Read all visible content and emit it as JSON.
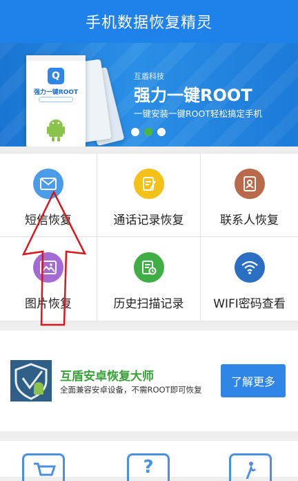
{
  "app": {
    "title": "手机数据恢复精灵"
  },
  "banner": {
    "brand": "互盾科技",
    "headline": "强力一键ROOT",
    "subtitle": "一键安装一键ROOT轻松搞定手机",
    "phone_title": "强力一键ROOT",
    "slide_count": 3,
    "active_slide": 2
  },
  "features": [
    {
      "label": "短信恢复",
      "icon": "message-icon",
      "color": "#4a9ce8"
    },
    {
      "label": "通话记录恢复",
      "icon": "call-log-icon",
      "color": "#f3c117"
    },
    {
      "label": "联系人恢复",
      "icon": "contacts-icon",
      "color": "#b86a4b"
    },
    {
      "label": "图片恢复",
      "icon": "image-icon",
      "color": "#a46ad6"
    },
    {
      "label": "历史扫描记录",
      "icon": "history-icon",
      "color": "#3fae45"
    },
    {
      "label": "WIFI密码查看",
      "icon": "wifi-icon",
      "color": "#2a6fc2"
    }
  ],
  "ad": {
    "title": "互盾安卓恢复大师",
    "description": "全面兼容安卓设备，不需ROOT即可恢复",
    "button": "了解更多"
  },
  "bottom_icons": [
    "cart-icon",
    "help-icon",
    "info-icon"
  ],
  "colors": {
    "primary": "#1f82ea",
    "accent_green": "#4cb53a",
    "annotation_red": "#d8161b"
  }
}
